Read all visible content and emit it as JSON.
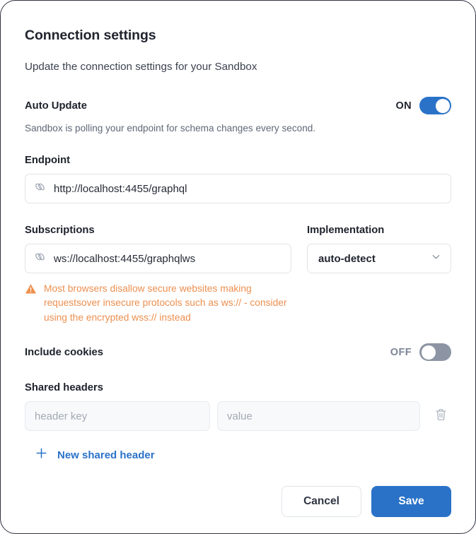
{
  "dialog": {
    "title": "Connection settings",
    "subtitle": "Update the connection settings for your Sandbox"
  },
  "auto_update": {
    "label": "Auto Update",
    "state_label": "ON",
    "state": "on",
    "helper": "Sandbox is polling your endpoint for schema changes every second."
  },
  "endpoint": {
    "label": "Endpoint",
    "value": "http://localhost:4455/graphql",
    "icon": "link-icon"
  },
  "subscriptions": {
    "label": "Subscriptions",
    "value": "ws://localhost:4455/graphqlws",
    "icon": "link-icon",
    "warning": "Most browsers disallow secure websites making requestsover insecure protocols such as ws:// - consider using the encrypted wss:// instead"
  },
  "implementation": {
    "label": "Implementation",
    "value": "auto-detect",
    "icon": "chevron-down-icon"
  },
  "include_cookies": {
    "label": "Include cookies",
    "state_label": "OFF",
    "state": "off"
  },
  "shared_headers": {
    "label": "Shared headers",
    "rows": [
      {
        "key_placeholder": "header key",
        "key_value": "",
        "value_placeholder": "value",
        "value_value": "",
        "delete_icon": "trash-icon"
      }
    ],
    "add_label": "New shared header",
    "add_icon": "plus-icon"
  },
  "footer": {
    "cancel_label": "Cancel",
    "save_label": "Save"
  },
  "colors": {
    "accent_blue": "#2a72c8",
    "warning_orange": "#ed8f4f",
    "toggle_off_gray": "#8d94a3",
    "border_gray": "#dfe3e8"
  }
}
